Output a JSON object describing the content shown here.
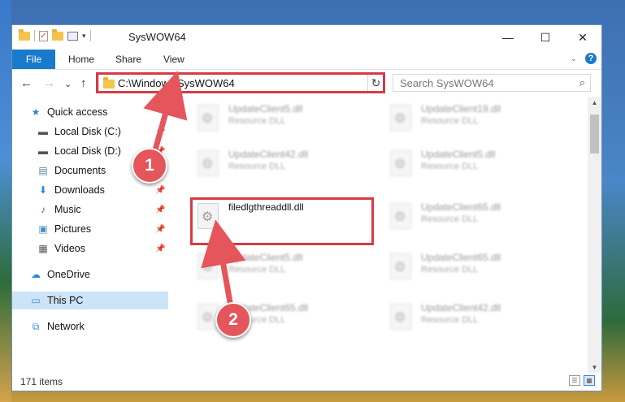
{
  "window": {
    "title": "SysWOW64",
    "controls": {
      "minimize": "—",
      "maximize": "☐",
      "close": "✕"
    }
  },
  "quick_access_toolbar": {
    "dropdown_arrow": "▾",
    "check_glyph": "✓"
  },
  "ribbon": {
    "tabs": [
      "File",
      "Home",
      "Share",
      "View"
    ],
    "expand_glyph": "⌄",
    "help_glyph": "?"
  },
  "nav": {
    "back": "←",
    "forward": "→",
    "recent": "⌄",
    "up": "↑",
    "address": "C:\\Windows\\SysWOW64",
    "address_dropdown": "⌄",
    "refresh": "↻",
    "search_placeholder": "Search SysWOW64",
    "search_glyph": "⌕"
  },
  "sidebar": {
    "items": [
      {
        "label": "Quick access",
        "icon": "star-icon",
        "glyph": "★",
        "color": "#2b88d8"
      },
      {
        "label": "Local Disk (C:)",
        "icon": "drive-icon",
        "glyph": "▬",
        "color": "#555555"
      },
      {
        "label": "Local Disk (D:)",
        "icon": "drive-icon",
        "glyph": "▬",
        "color": "#555555"
      },
      {
        "label": "Documents",
        "icon": "documents-icon",
        "glyph": "▤",
        "color": "#5b7fa6"
      },
      {
        "label": "Downloads",
        "icon": "downloads-icon",
        "glyph": "⬇",
        "color": "#2b88d8"
      },
      {
        "label": "Music",
        "icon": "music-icon",
        "glyph": "♪",
        "color": "#3a6ea5"
      },
      {
        "label": "Pictures",
        "icon": "pictures-icon",
        "glyph": "▣",
        "color": "#4c8ec4"
      },
      {
        "label": "Videos",
        "icon": "videos-icon",
        "glyph": "▦",
        "color": "#555555"
      },
      {
        "label": "OneDrive",
        "icon": "cloud-icon",
        "glyph": "☁",
        "color": "#2b88d8"
      },
      {
        "label": "This PC",
        "icon": "computer-icon",
        "glyph": "▭",
        "color": "#3a8ad0"
      },
      {
        "label": "Network",
        "icon": "network-icon",
        "glyph": "⧉",
        "color": "#3a8ad0"
      }
    ],
    "pin_glyph": "📌"
  },
  "files": [
    {
      "name": "UpdateClient5.dll",
      "type": "Resource DLL"
    },
    {
      "name": "UpdateClient19.dll",
      "type": "Resource DLL"
    },
    {
      "name": "UpdateClient42.dll",
      "type": "Resource DLL"
    },
    {
      "name": "UpdateClient5.dll",
      "type": "Resource DLL"
    },
    {
      "name": "filedlgthreaddll.dll",
      "type": ""
    },
    {
      "name": "UpdateClient65.dll",
      "type": "Resource DLL"
    },
    {
      "name": "UpdateClient5.dll",
      "type": "Resource DLL"
    },
    {
      "name": "UpdateClient65.dll",
      "type": "Resource DLL"
    },
    {
      "name": "UpdateClient65.dll",
      "type": "Resource DLL"
    },
    {
      "name": "UpdateClient42.dll",
      "type": "Resource DLL"
    }
  ],
  "scrollbar": {
    "up": "▲",
    "down": "▼"
  },
  "status": {
    "item_count": "171 items",
    "details_view_glyph": "☰",
    "icons_view_glyph": "▦"
  },
  "annotations": [
    {
      "number": "1"
    },
    {
      "number": "2"
    }
  ],
  "colors": {
    "accent": "#1979ca",
    "highlight_red": "#d63b45",
    "badge_red": "#e5555c",
    "selection": "#cce4f7"
  }
}
